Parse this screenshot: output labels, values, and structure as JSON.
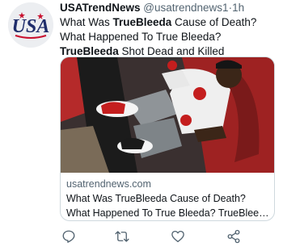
{
  "account": {
    "display_name": "USATrendNews",
    "handle": "@usatrendnews1",
    "separator": "·",
    "time": "1h",
    "avatar_logo_text": "USA"
  },
  "tweet": {
    "seg1": "What Was ",
    "seg2": "TrueBleeda",
    "seg3": " Cause of Death? What Happened To True Bleeda? ",
    "seg4": "TrueBleeda",
    "seg5": " Shot Dead and Killed"
  },
  "card": {
    "domain": "usatrendnews.com",
    "title_line1": "What Was TrueBleeda Cause of Death?",
    "title_line2": "What Happened To True Bleeda? TrueBleed..."
  },
  "actions": {
    "reply_icon": "reply-icon",
    "retweet_icon": "retweet-icon",
    "like_icon": "heart-icon",
    "share_icon": "share-icon"
  },
  "colors": {
    "primary_text": "#0f1419",
    "secondary_text": "#536471",
    "border": "#cfd9de",
    "logo_blue": "#1f2d6b",
    "logo_red": "#c8102e"
  }
}
